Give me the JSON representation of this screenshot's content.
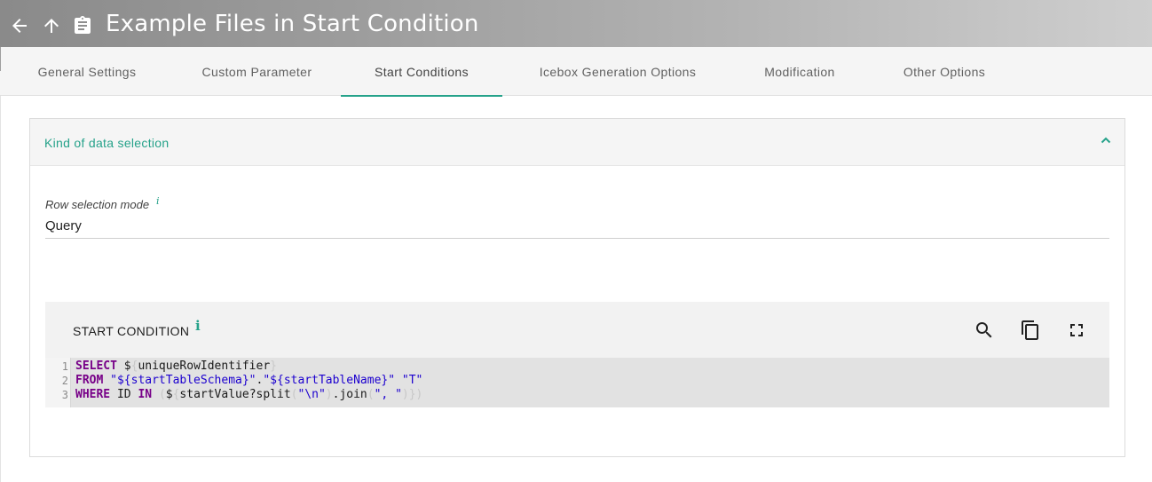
{
  "header": {
    "title": "Example Files in Start Condition",
    "icons": {
      "back": "arrow-back-icon",
      "up": "arrow-up-icon",
      "clipboard": "clipboard-icon"
    }
  },
  "tabs": [
    {
      "label": "General Settings"
    },
    {
      "label": "Custom Parameter"
    },
    {
      "label": "Start Conditions",
      "active": true
    },
    {
      "label": "Icebox Generation Options"
    },
    {
      "label": "Modification"
    },
    {
      "label": "Other Options"
    }
  ],
  "panel": {
    "title": "Kind of data selection",
    "row_selection": {
      "label": "Row selection mode",
      "info": "i",
      "value": "Query"
    },
    "editor": {
      "title": "START CONDITION",
      "info": "i",
      "tools": [
        "search-icon",
        "copy-icon",
        "fullscreen-icon"
      ],
      "lines": [
        {
          "number": "1",
          "kw1": "SELECT",
          "t1": " $",
          "b1": "{",
          "t2": "uniqueRowIdentifier",
          "b2": "}"
        },
        {
          "number": "2",
          "kw1": "FROM",
          "s1": "\"${startTableSchema}\"",
          "t1": ".",
          "s2": "\"${startTableName}\"",
          "s3": "\"T\""
        },
        {
          "number": "3",
          "kw1": "WHERE",
          "t1": " ID ",
          "kw2": "IN",
          "b1": "(",
          "t2": "$",
          "b2": "{",
          "t3": "startValue?split",
          "b3": "(",
          "s1": "\"\\n\"",
          "b4": ")",
          "t4": ".join",
          "b5": "(",
          "s2": "\", \"",
          "b6": ")})"
        }
      ]
    }
  },
  "colors": {
    "accent": "#26a28a",
    "keyword": "#770088",
    "string": "#1c00cf"
  }
}
